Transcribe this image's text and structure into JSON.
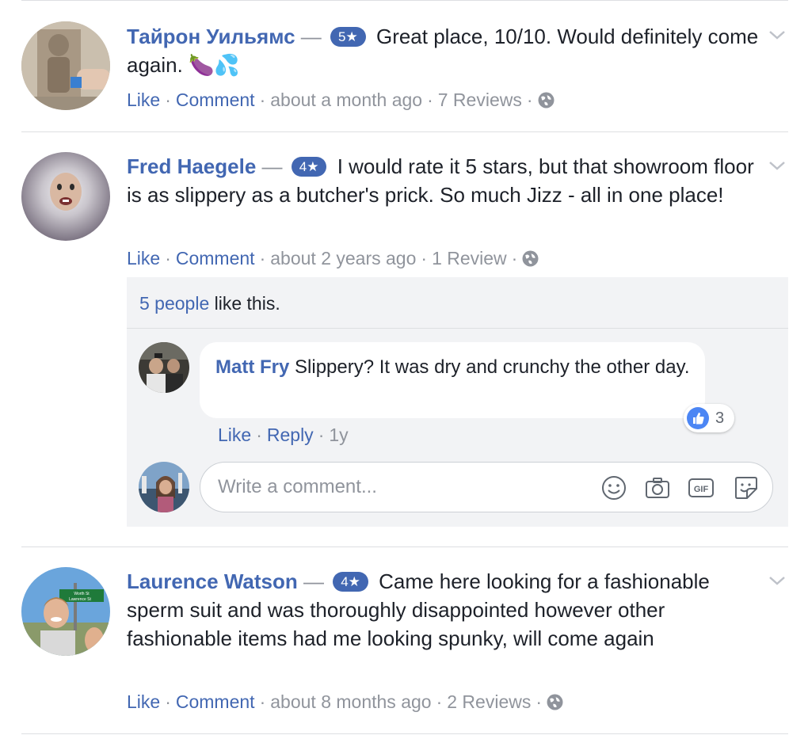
{
  "reviews": [
    {
      "author": "Тайрон Уильямс",
      "dash": "—",
      "rating": "5★",
      "text": "Great place, 10/10. Would definitely come again. 🍆💦",
      "actions": {
        "like": "Like",
        "comment": "Comment",
        "time": "about a month ago",
        "reviews": "7 Reviews"
      }
    },
    {
      "author": "Fred Haegele",
      "dash": "—",
      "rating": "4★",
      "text": "I would rate it 5 stars, but that showroom floor is as slippery as a butcher's prick. So much Jizz - all in one place!",
      "actions": {
        "like": "Like",
        "comment": "Comment",
        "time": "about 2 years ago",
        "reviews": "1 Review"
      },
      "likes_summary": {
        "people": "5 people",
        "rest": "like this."
      },
      "comments": [
        {
          "author": "Matt Fry",
          "text": "Slippery? It was dry and crunchy the other day.",
          "reaction_count": "3",
          "actions": {
            "like": "Like",
            "reply": "Reply",
            "time": "1y"
          }
        }
      ],
      "compose": {
        "placeholder": "Write a comment...",
        "icons": [
          "emoji-icon",
          "camera-icon",
          "gif-icon",
          "sticker-icon"
        ]
      }
    },
    {
      "author": "Laurence Watson",
      "dash": "—",
      "rating": "4★",
      "text": "Came here looking for a fashionable sperm suit and was thoroughly disappointed however other fashionable items had me looking spunky, will come again",
      "actions": {
        "like": "Like",
        "comment": "Comment",
        "time": "about 8 months ago",
        "reviews": "2 Reviews"
      }
    }
  ],
  "colors": {
    "link": "#4267b2",
    "meta": "#90949c",
    "text": "#1d2129",
    "panel_bg": "#f2f3f5",
    "divider": "#dddfe2",
    "like_blue": "#4c86f4"
  },
  "sign_text": "Worth St / Lawrence St"
}
